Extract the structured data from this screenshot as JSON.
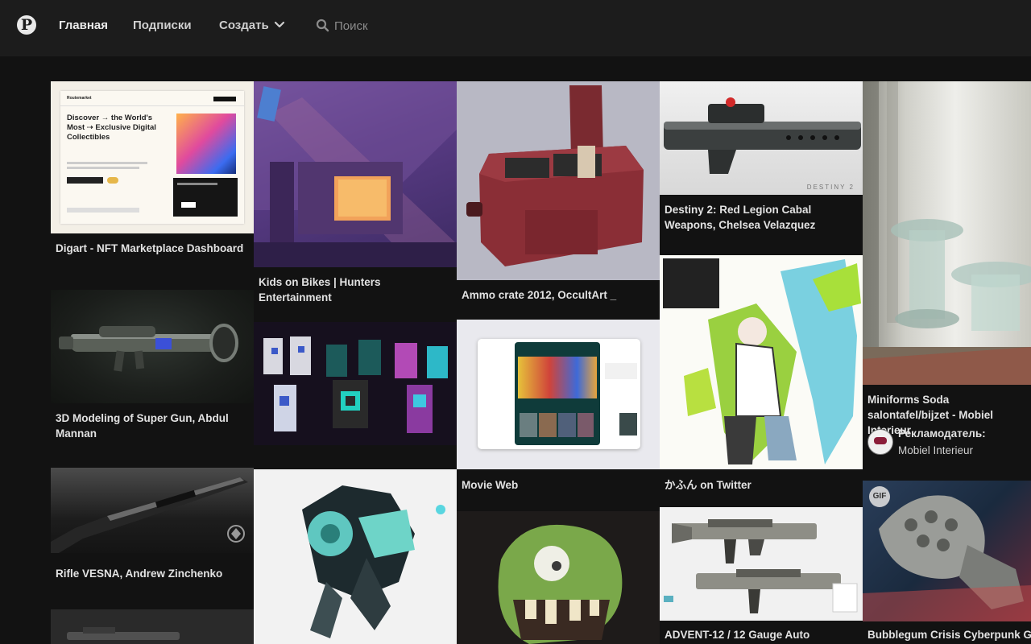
{
  "header": {
    "logo_letter": "P",
    "nav": {
      "home": "Главная",
      "following": "Подписки",
      "create": "Создать"
    },
    "search": {
      "placeholder": "Поиск",
      "value": ""
    }
  },
  "pins": {
    "digart": {
      "title": "Digart - NFT Marketplace Dashboard",
      "image": {
        "brand": "Routemarket",
        "heading": "Discover → the World's Most ⇢ Exclusive Digital Collectibles"
      }
    },
    "kids_on_bikes": {
      "title": "Kids on Bikes | Hunters Entertainment"
    },
    "ammo_crate": {
      "title": "Ammo crate 2012, OccultArt _"
    },
    "destiny": {
      "title": "Destiny 2: Red Legion Cabal Weapons, Chelsea Velazquez",
      "image": {
        "watermark": "DESTINY 2"
      }
    },
    "miniforms": {
      "title": "Miniforms Soda salontafel/bijzet - Mobiel Interieur",
      "ad_label": "Рекламодатель:",
      "advertiser": "Mobiel Interieur"
    },
    "super_gun": {
      "title": "3D Modeling of Super Gun, Abdul Mannan"
    },
    "minecraft": {
      "title": ""
    },
    "movie_web": {
      "title": "Movie Web"
    },
    "kafun": {
      "title": "かふん on Twitter"
    },
    "rifle_vesna": {
      "title": "Rifle VESNA, Andrew Zinchenko"
    },
    "advent": {
      "title": "ADVENT-12 / 12 Gauge Auto"
    },
    "bubblegum": {
      "title": "Bubblegum Crisis Cyberpunk GIF",
      "badge": "GIF"
    }
  },
  "colors": {
    "background": "#121212",
    "header": "#1c1c1c",
    "text": "#e2e2e2",
    "muted": "#8c8c8c"
  },
  "icons": [
    "pinterest-logo-icon",
    "chevron-down-icon",
    "search-icon",
    "gif-badge"
  ]
}
